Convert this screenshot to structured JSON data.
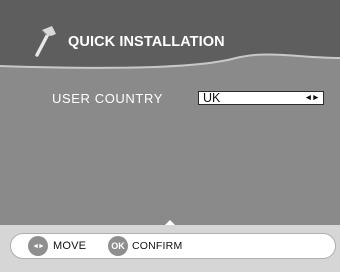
{
  "header": {
    "title": "QUICK INSTALLATION",
    "icon": "hammer-icon"
  },
  "settings": {
    "user_country": {
      "label": "USER COUNTRY",
      "value": "UK",
      "arrows": "◄►"
    }
  },
  "hints": {
    "move": {
      "glyph": "◄►",
      "label": "MOVE",
      "icon": "left-right-icon"
    },
    "confirm": {
      "glyph": "OK",
      "label": "CONFIRM",
      "icon": "ok-icon"
    }
  },
  "colors": {
    "panel": "#8a8a8a",
    "header_band": "#5e5e5e",
    "header_wave": "#c8c8c8",
    "bottom_strip": "#d6d6d6",
    "button_gray": "#8f8f8f"
  }
}
